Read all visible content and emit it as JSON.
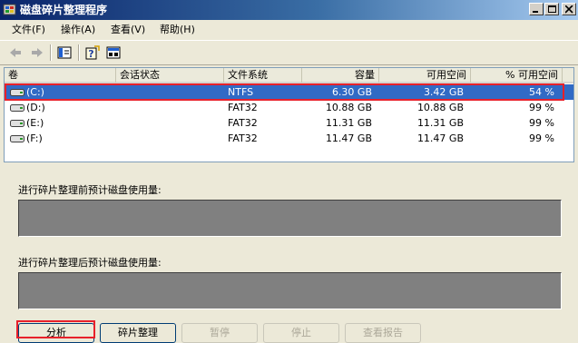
{
  "window": {
    "title": "磁盘碎片整理程序"
  },
  "menu": [
    "文件(F)",
    "操作(A)",
    "查看(V)",
    "帮助(H)"
  ],
  "toolbar": {
    "buttons": [
      "back-arrow-icon",
      "forward-arrow-icon",
      "properties-icon",
      "help-icon",
      "view-icon"
    ]
  },
  "volumes": {
    "columns": [
      "卷",
      "会话状态",
      "文件系统",
      "容量",
      "可用空间",
      "% 可用空间"
    ],
    "rows": [
      {
        "volume": "(C:)",
        "status": "",
        "fs": "NTFS",
        "capacity": "6.30 GB",
        "free": "3.42 GB",
        "pct": "54 %",
        "selected": true
      },
      {
        "volume": "(D:)",
        "status": "",
        "fs": "FAT32",
        "capacity": "10.88 GB",
        "free": "10.88 GB",
        "pct": "99 %",
        "selected": false
      },
      {
        "volume": "(E:)",
        "status": "",
        "fs": "FAT32",
        "capacity": "11.31 GB",
        "free": "11.31 GB",
        "pct": "99 %",
        "selected": false
      },
      {
        "volume": "(F:)",
        "status": "",
        "fs": "FAT32",
        "capacity": "11.47 GB",
        "free": "11.47 GB",
        "pct": "99 %",
        "selected": false
      }
    ]
  },
  "usage": {
    "before_label": "进行碎片整理前预计磁盘使用量:",
    "after_label": "进行碎片整理后预计磁盘使用量:"
  },
  "buttons": {
    "analyze": "分析",
    "defrag": "碎片整理",
    "pause": "暂停",
    "stop": "停止",
    "report": "查看报告"
  },
  "colors": {
    "selection": "#316ac5",
    "highlight_box": "#e8202a",
    "usage_bar": "#808080"
  }
}
